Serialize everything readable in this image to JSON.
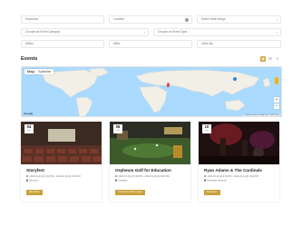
{
  "filters": {
    "keywords": "Keywords",
    "location": "Location",
    "date_range": "Select Date Range",
    "category": "Choose an Event Category",
    "type": "Choose an Event Type",
    "within": "Within",
    "miles": "Miles",
    "order_by": "Order By"
  },
  "section_title": "Events",
  "map": {
    "map_label": "Map",
    "satellite_label": "Satellite",
    "zoom_in": "+",
    "zoom_out": "−",
    "attribution": "Keyboard shortcuts  Map data ©2024  Terms",
    "google": "Google"
  },
  "events": [
    {
      "day": "04",
      "month": "Jan",
      "title": "Storyfest",
      "datetime": "2024-01-04 @ 6:30 PM - 2024-01-04 @ 9:00 PM",
      "venue": "Sanorita",
      "category": "Education"
    },
    {
      "day": "06",
      "month": "Jan",
      "title": "Orpheum Golf for Education",
      "datetime": "2024-01-06 @ 6:00 PM - 2024-01-06 @ 8:00 PM",
      "venue": "Colorado",
      "category": "Concert & Performance"
    },
    {
      "day": "10",
      "month": "Jan",
      "title": "Ryan Adams & The Cardinals",
      "datetime": "2024-01-10 @ 6:00 PM - 2024-01-10 @ 9:00 PM",
      "venue": "Riverside Ventures",
      "category": "Education"
    }
  ],
  "colors": {
    "accent": "#c9a13b",
    "map_water": "#aadaff",
    "map_land": "#f2efe6"
  }
}
